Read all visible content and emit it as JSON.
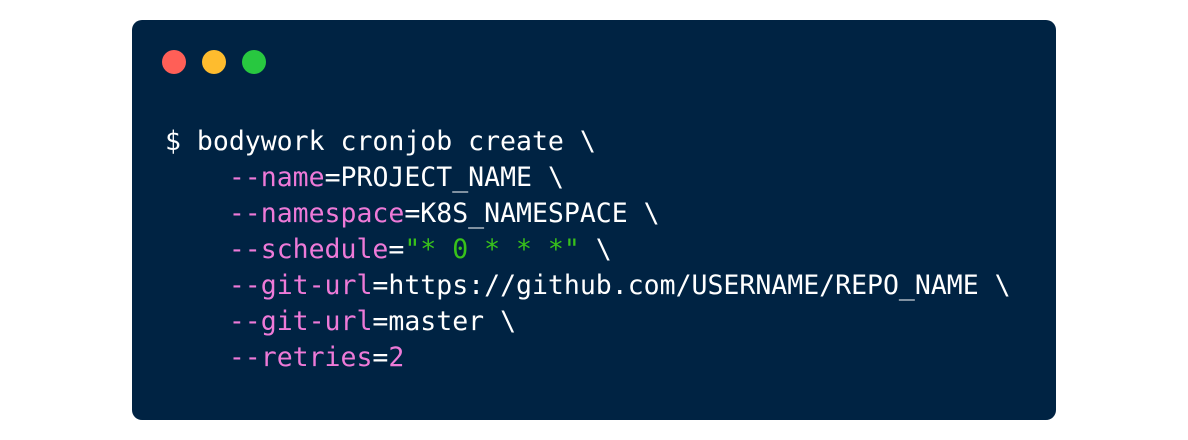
{
  "window": {
    "controls": [
      {
        "name": "close-light",
        "color": "#ff5f57"
      },
      {
        "name": "minimize-light",
        "color": "#febc2e"
      },
      {
        "name": "maximize-light",
        "color": "#28c840"
      }
    ]
  },
  "colors": {
    "background": "#002343",
    "text": "#ffffff",
    "flag": "#ee7ad8",
    "string": "#38c21a"
  },
  "code": {
    "line1": "$ bodywork cronjob create \\",
    "line2": {
      "flag": "--name",
      "eq": "=",
      "value": "PROJECT_NAME \\"
    },
    "line3": {
      "flag": "--namespace",
      "eq": "=",
      "value": "K8S_NAMESPACE \\"
    },
    "line4": {
      "flag": "--schedule",
      "eq": "=",
      "string": "\"* 0 * * *\"",
      "tail": " \\"
    },
    "line5": {
      "flag": "--git-url",
      "eq": "=",
      "value": "https://github.com/USERNAME/REPO_NAME \\"
    },
    "line6": {
      "flag": "--git-url",
      "eq": "=",
      "value": "master \\"
    },
    "line7": {
      "flag": "--retries",
      "eq": "=",
      "number": "2"
    }
  }
}
